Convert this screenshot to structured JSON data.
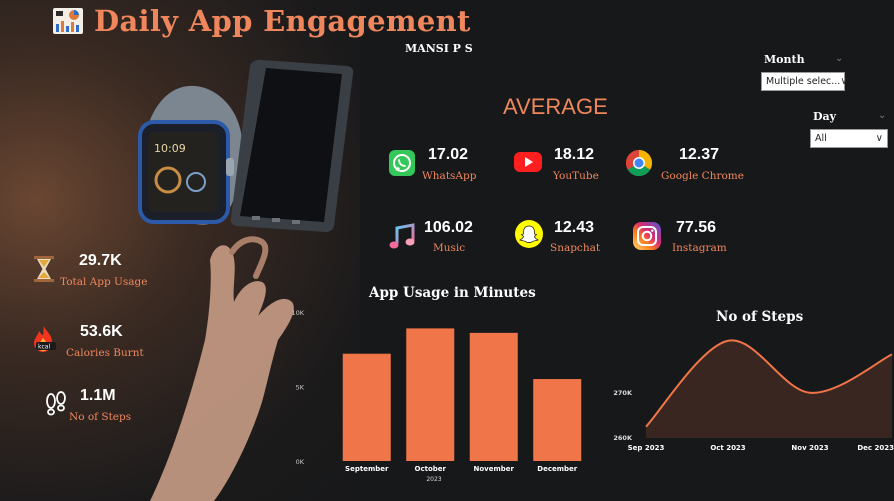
{
  "title": "Daily App Engagement",
  "author": "MANSI P S",
  "filters": {
    "month": {
      "label": "Month",
      "value": "Multiple selec..."
    },
    "day": {
      "label": "Day",
      "value": "All"
    }
  },
  "average": {
    "heading": "AVERAGE",
    "apps": [
      {
        "name": "WhatsApp",
        "value": "17.02",
        "icon": "whatsapp-icon"
      },
      {
        "name": "YouTube",
        "value": "18.12",
        "icon": "youtube-icon"
      },
      {
        "name": "Google Chrome",
        "value": "12.37",
        "icon": "chrome-icon"
      },
      {
        "name": "Music",
        "value": "106.02",
        "icon": "music-icon"
      },
      {
        "name": "Snapchat",
        "value": "12.43",
        "icon": "snapchat-icon"
      },
      {
        "name": "Instagram",
        "value": "77.56",
        "icon": "instagram-icon"
      }
    ]
  },
  "kpis": [
    {
      "value": "29.7K",
      "label": "Total App Usage",
      "icon": "hourglass-icon"
    },
    {
      "value": "53.6K",
      "label": "Calories Burnt",
      "icon": "kcal-fire-icon"
    },
    {
      "value": "1.1M",
      "label": "No of Steps",
      "icon": "footsteps-icon"
    }
  ],
  "colors": {
    "accent": "#f0875c",
    "bar": "#f07548",
    "background": "#17181a"
  },
  "chart_data": [
    {
      "type": "bar",
      "title": "App Usage in Minutes",
      "categories": [
        "September",
        "October",
        "November",
        "December"
      ],
      "values": [
        7200,
        8900,
        8600,
        5500
      ],
      "xlabel": "2023",
      "ylabel": "",
      "ylim": [
        0,
        10000
      ],
      "yticks": [
        "0K",
        "5K",
        "10K"
      ],
      "grid": false
    },
    {
      "type": "area",
      "title": "No of Steps",
      "x": [
        "Sep 2023",
        "Oct 2023",
        "Nov 2023",
        "Dec 2023"
      ],
      "values": [
        262500,
        281500,
        270000,
        278500
      ],
      "ylim": [
        260000,
        283000
      ],
      "yticks": [
        "260K",
        "270K"
      ],
      "grid": false
    }
  ]
}
